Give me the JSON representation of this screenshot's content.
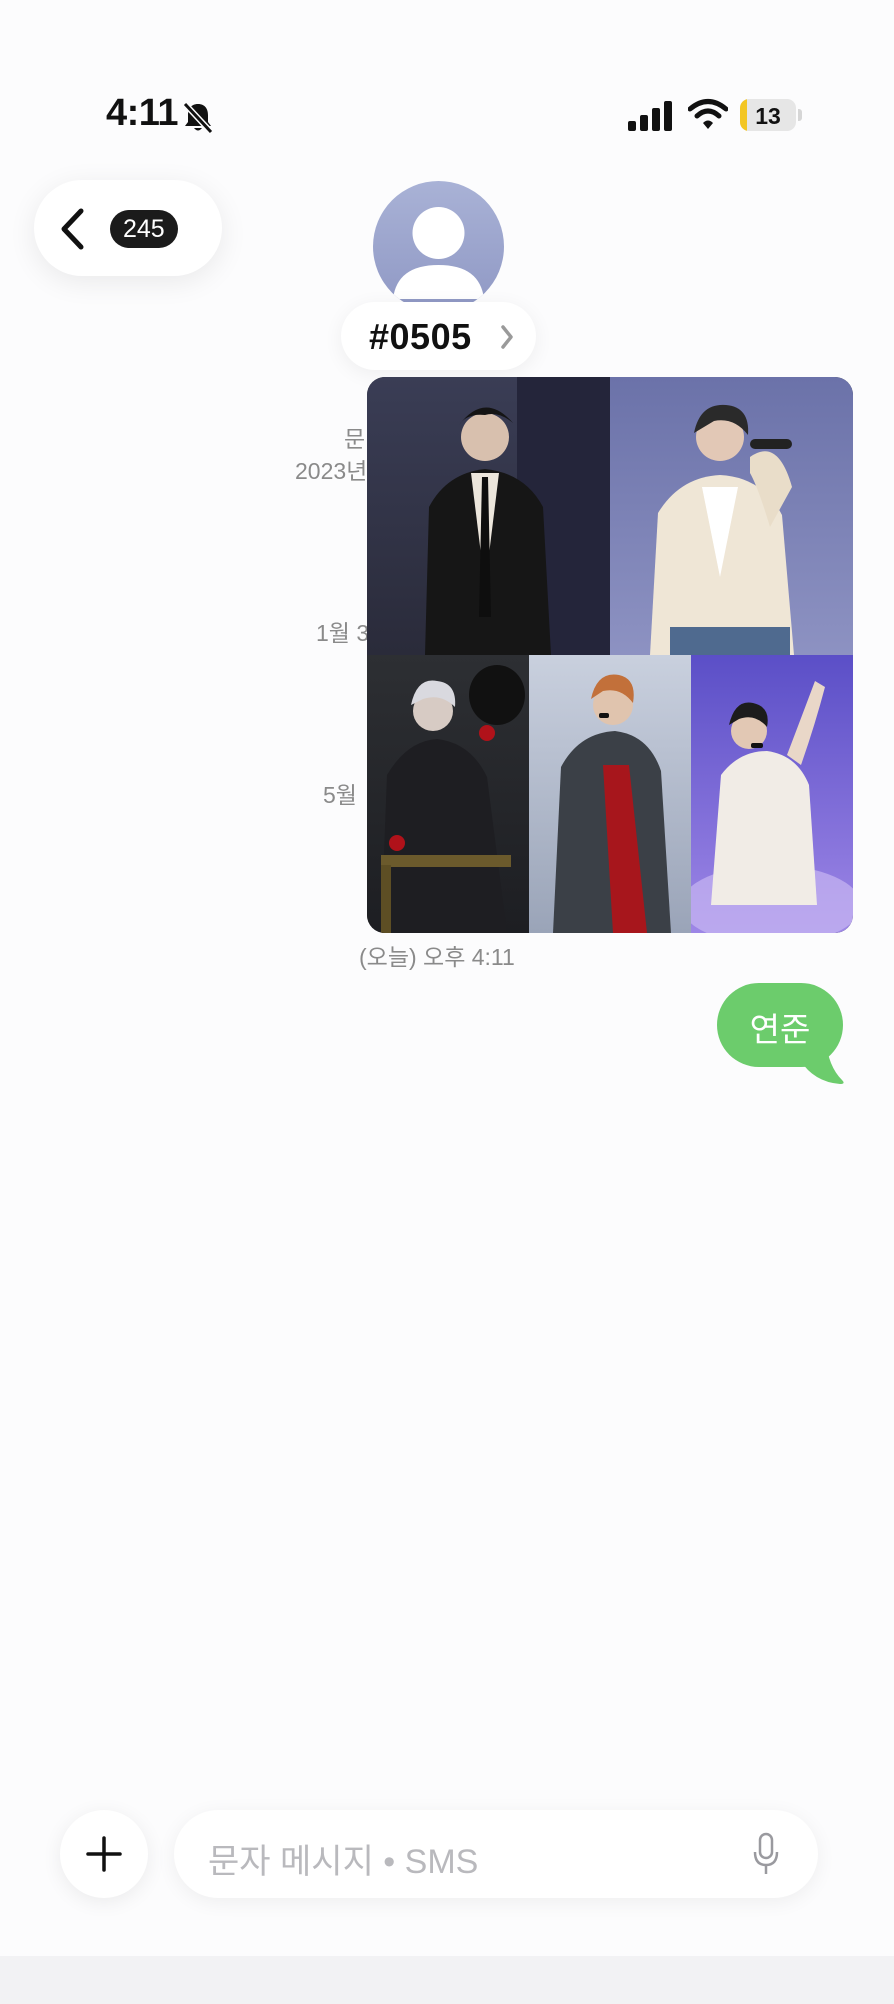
{
  "status_bar": {
    "time": "4:11",
    "battery": "13",
    "battery_level": 0.13,
    "icons": [
      "bell-off-icon",
      "signal-icon",
      "wifi-icon",
      "battery-icon"
    ]
  },
  "header": {
    "back_count": "245",
    "contact_name": "#0505"
  },
  "history": {
    "line1": "문",
    "line2": "2023년",
    "line3": "1월 3",
    "line4": "5월"
  },
  "message": {
    "image_count": 5,
    "timestamp": "(오늘) 오후 4:11",
    "text": "연준"
  },
  "composer": {
    "placeholder": "문자 메시지 • SMS"
  },
  "colors": {
    "bubble": "#6ccc6c",
    "battery_fill": "#f3c623",
    "avatar": "#9aa2cc"
  }
}
